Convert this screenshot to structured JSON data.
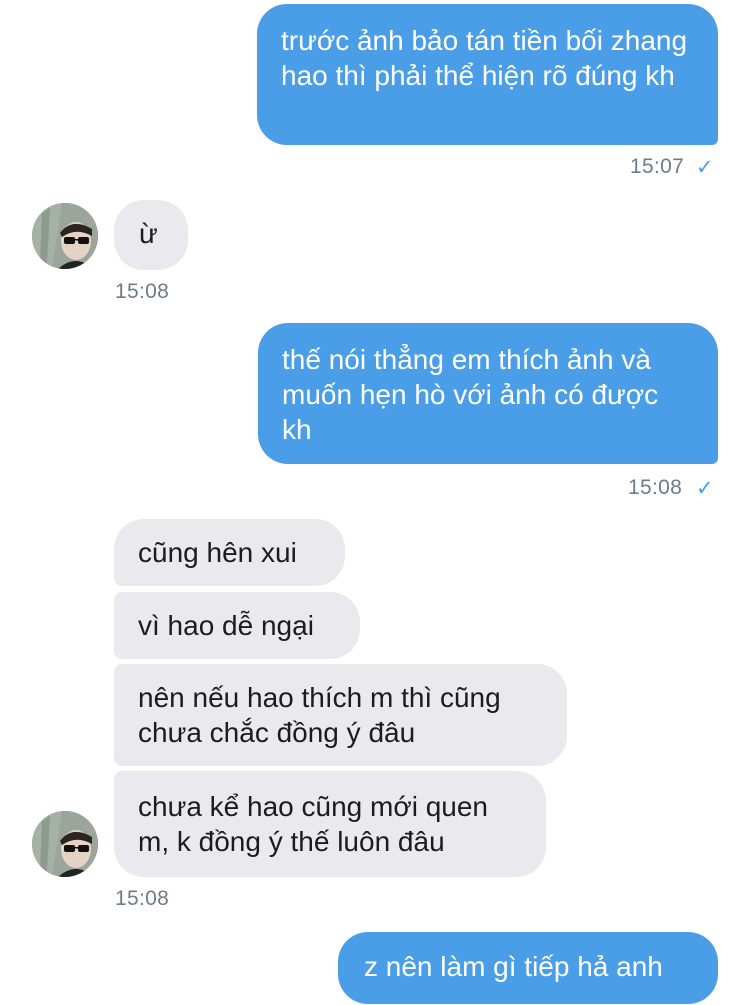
{
  "messages": [
    {
      "id": "m1",
      "direction": "sent",
      "text": "trước ảnh bảo tán tiền bối zhang hao thì phải thể hiện rõ đúng kh",
      "time": "15:07",
      "read_mark": "✓"
    },
    {
      "id": "m2",
      "direction": "received",
      "text": "ừ",
      "time": "15:08"
    },
    {
      "id": "m3",
      "direction": "sent",
      "text": "thế nói thẳng em thích ảnh và muốn hẹn hò với ảnh có được kh",
      "time": "15:08",
      "read_mark": "✓"
    },
    {
      "id": "m4",
      "direction": "received",
      "text": "cũng hên xui"
    },
    {
      "id": "m5",
      "direction": "received",
      "text": "vì hao dễ ngại"
    },
    {
      "id": "m6",
      "direction": "received",
      "text": "nên nếu hao thích m thì cũng chưa chắc đồng ý đâu"
    },
    {
      "id": "m7",
      "direction": "received",
      "text": "chưa kể hao cũng mới quen m, k đồng ý thế luôn đâu",
      "time": "15:08"
    },
    {
      "id": "m8",
      "direction": "sent",
      "text": "z nên làm gì tiếp hả anh"
    }
  ],
  "colors": {
    "sent_bubble": "#4a9ee8",
    "received_bubble": "#e9e9ee",
    "timestamp": "#6e7b88"
  },
  "icons": {
    "read_receipt": "check-icon",
    "avatar": "avatar-photo"
  }
}
